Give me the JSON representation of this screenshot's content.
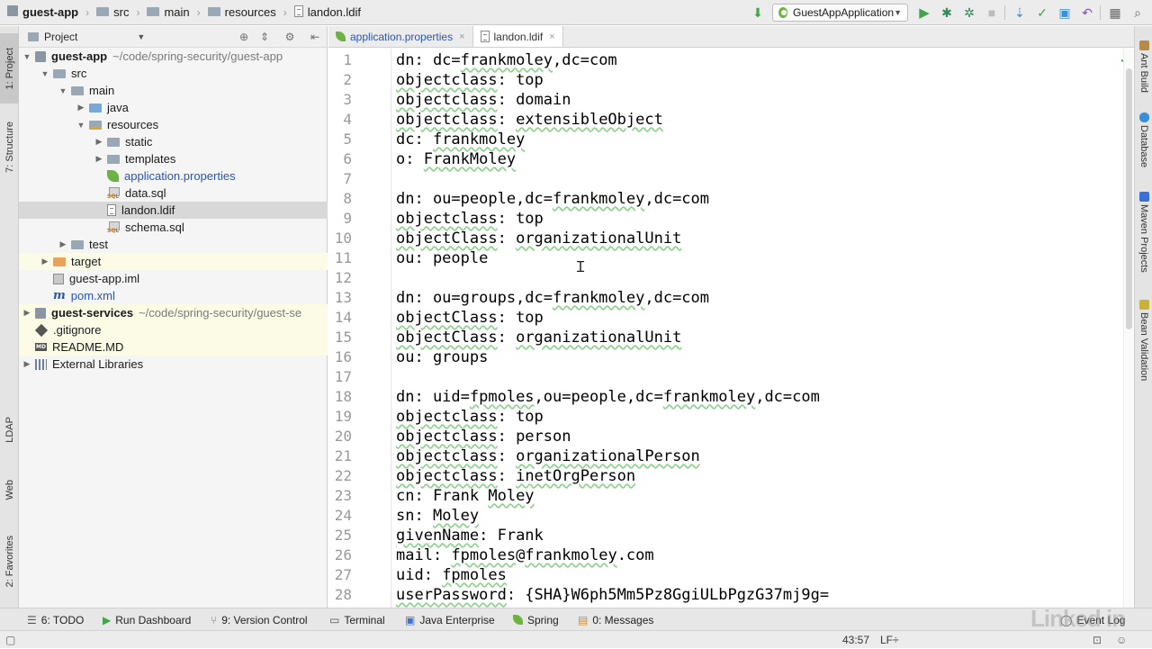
{
  "breadcrumbs": [
    "guest-app",
    "src",
    "main",
    "resources",
    "landon.ldif"
  ],
  "run_config": "GuestAppApplication",
  "project_panel": {
    "title": "Project",
    "tree": [
      {
        "label": "guest-app",
        "path": "~/code/spring-security/guest-app",
        "icon": "module-folder-icon",
        "indent": 0,
        "expand": "open"
      },
      {
        "label": "src",
        "icon": "folder-icon",
        "indent": 1,
        "expand": "open"
      },
      {
        "label": "main",
        "icon": "folder-icon",
        "indent": 2,
        "expand": "open"
      },
      {
        "label": "java",
        "icon": "source-folder-icon",
        "indent": 3,
        "expand": "closed"
      },
      {
        "label": "resources",
        "icon": "resources-folder-icon",
        "indent": 3,
        "expand": "open"
      },
      {
        "label": "static",
        "icon": "folder-icon",
        "indent": 4,
        "expand": "closed"
      },
      {
        "label": "templates",
        "icon": "folder-icon",
        "indent": 4,
        "expand": "closed"
      },
      {
        "label": "application.properties",
        "icon": "spring-properties-icon",
        "indent": 4,
        "expand": "none"
      },
      {
        "label": "data.sql",
        "icon": "sql-file-icon",
        "indent": 4,
        "expand": "none"
      },
      {
        "label": "landon.ldif",
        "icon": "text-file-icon",
        "indent": 4,
        "expand": "none"
      },
      {
        "label": "schema.sql",
        "icon": "sql-file-icon",
        "indent": 4,
        "expand": "none"
      },
      {
        "label": "test",
        "icon": "folder-icon",
        "indent": 2,
        "expand": "closed"
      },
      {
        "label": "target",
        "icon": "excluded-folder-icon",
        "indent": 1,
        "expand": "closed"
      },
      {
        "label": "guest-app.iml",
        "icon": "iml-file-icon",
        "indent": 1,
        "expand": "none"
      },
      {
        "label": "pom.xml",
        "icon": "maven-icon",
        "indent": 1,
        "expand": "none"
      },
      {
        "label": "guest-services",
        "path": "~/code/spring-security/guest-se",
        "icon": "module-folder-icon",
        "indent": 0,
        "expand": "closed"
      },
      {
        "label": ".gitignore",
        "icon": "git-icon",
        "indent": 0,
        "expand": "none"
      },
      {
        "label": "README.MD",
        "icon": "markdown-icon",
        "indent": 0,
        "expand": "none"
      },
      {
        "label": "External Libraries",
        "icon": "libraries-icon",
        "indent": 0,
        "expand": "closed"
      }
    ]
  },
  "editor_tabs": [
    {
      "label": "application.properties",
      "close": "×"
    },
    {
      "label": "landon.ldif",
      "close": "×"
    }
  ],
  "code_lines": [
    "dn: dc=frankmoley,dc=com",
    "objectclass: top",
    "objectclass: domain",
    "objectclass: extensibleObject",
    "dc: frankmoley",
    "o: FrankMoley",
    "",
    "dn: ou=people,dc=frankmoley,dc=com",
    "objectclass: top",
    "objectClass: organizationalUnit",
    "ou: people",
    "",
    "dn: ou=groups,dc=frankmoley,dc=com",
    "objectClass: top",
    "objectClass: organizationalUnit",
    "ou: groups",
    "",
    "dn: uid=fpmoles,ou=people,dc=frankmoley,dc=com",
    "objectclass: top",
    "objectclass: person",
    "objectclass: organizationalPerson",
    "objectclass: inetOrgPerson",
    "cn: Frank Moley",
    "sn: Moley",
    "givenName: Frank",
    "mail: fpmoles@frankmoley.com",
    "uid: fpmoles",
    "userPassword: {SHA}W6ph5Mm5Pz8GgiULbPgzG37mj9g="
  ],
  "left_stripe": [
    "1: Project",
    "7: Structure",
    "LDAP",
    "Web",
    "2: Favorites"
  ],
  "right_stripe": [
    "Ant Build",
    "Database",
    "Maven Projects",
    "Bean Validation"
  ],
  "tool_windows": [
    {
      "label": "6: TODO",
      "icon": "todo-icon"
    },
    {
      "label": "Run Dashboard",
      "icon": "run-icon"
    },
    {
      "label": "9: Version Control",
      "icon": "vcs-icon"
    },
    {
      "label": "Terminal",
      "icon": "terminal-icon"
    },
    {
      "label": "Java Enterprise",
      "icon": "java-enterprise-icon"
    },
    {
      "label": "Spring",
      "icon": "spring-icon"
    },
    {
      "label": "0: Messages",
      "icon": "messages-icon"
    },
    {
      "label": "Event Log",
      "icon": "event-log-icon"
    }
  ],
  "status": {
    "position": "43:57",
    "line_separator": "LF÷"
  },
  "watermark": "Linked in",
  "colors": {
    "accent_blue": "#2954b8",
    "run_green": "#3fa64a",
    "debug_green": "#2e8b57",
    "selection": "#d8d8d8",
    "ignored_bg": "#fbfbe6"
  }
}
